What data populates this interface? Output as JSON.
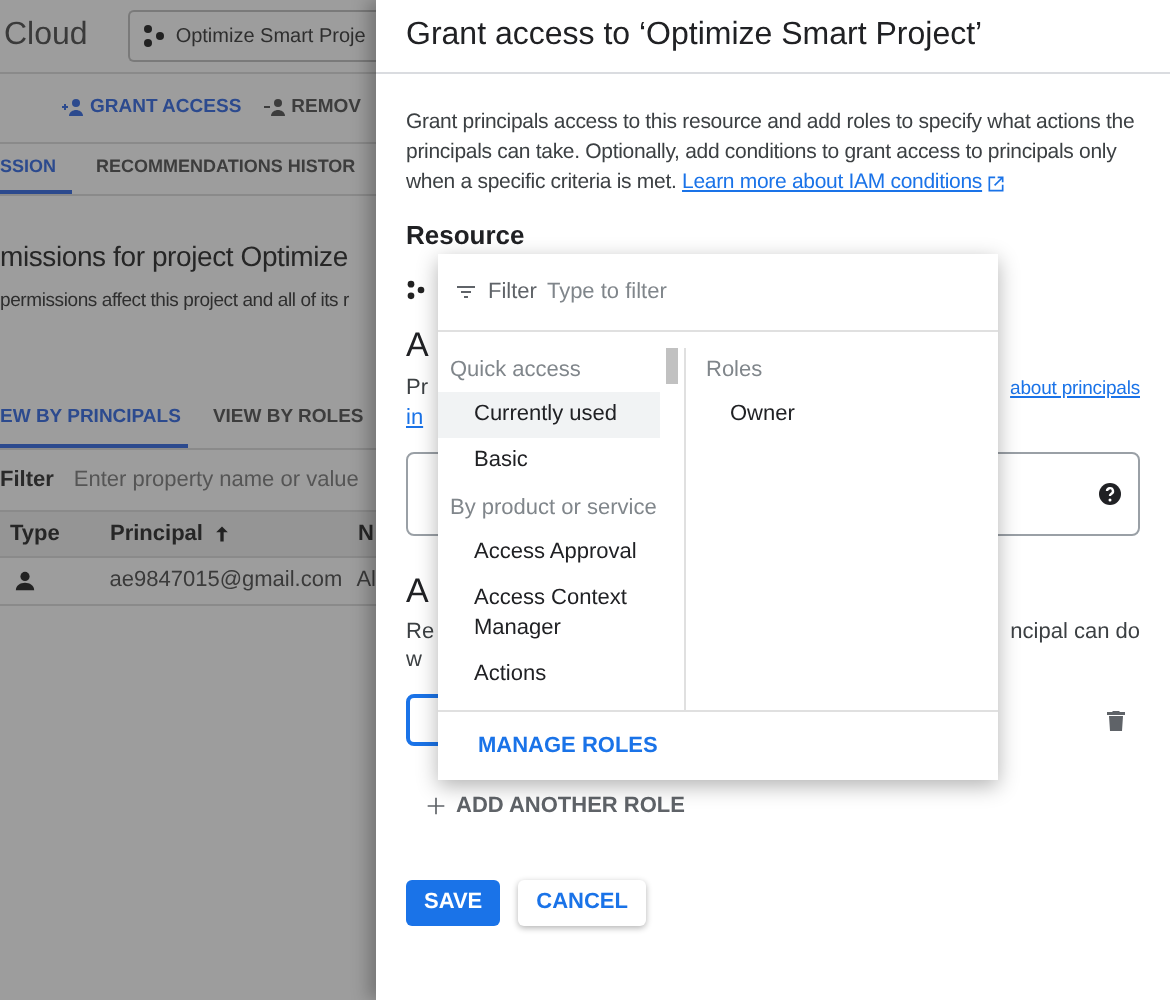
{
  "background_page": {
    "brand": "Cloud",
    "project_selector": "Optimize Smart Proje",
    "toolbar": [
      {
        "kind": "add",
        "label": "GRANT ACCESS"
      },
      {
        "kind": "remove",
        "label": "REMOV"
      }
    ],
    "tabs": [
      {
        "label": "SSION",
        "selected": true
      },
      {
        "label": "RECOMMENDATIONS HISTOR",
        "selected": false
      }
    ],
    "heading": "missions for project Optimize",
    "subtitle": "permissions affect this project and all of its r",
    "view_tabs": [
      {
        "label": "EW BY PRINCIPALS",
        "selected": true
      },
      {
        "label": "VIEW BY ROLES",
        "selected": false
      }
    ],
    "filter": {
      "label": "Filter",
      "placeholder": "Enter property name or value"
    },
    "table": {
      "columns": [
        "Type",
        "Principal",
        "N"
      ],
      "rows": [
        {
          "principal": "ae9847015@gmail.com",
          "column_3": "Al"
        }
      ]
    }
  },
  "panel": {
    "title": "Grant access to ‘Optimize Smart Project’",
    "description": "Grant principals access to this resource and add roles to specify what actions the principals can take. Optionally, add conditions to grant access to principals only when a specific criteria is met.",
    "learn_more_link": "Learn more about IAM conditions",
    "resource_label": "Resource",
    "principals_heading": "A",
    "principals_text": "Pr",
    "principals_text_2": "in",
    "principals_link": "about principals",
    "roles_heading": "A",
    "roles_text": "Re",
    "roles_text_end": "ncipal can do",
    "roles_text_2": "w",
    "add_another_role": "ADD ANOTHER ROLE",
    "buttons": [
      {
        "kind": "primary",
        "label": "SAVE"
      },
      {
        "kind": "secondary",
        "label": "CANCEL"
      }
    ]
  },
  "role_dropdown": {
    "filter_label": "Filter",
    "placeholder": "Type to filter",
    "groups": [
      {
        "heading": "Quick access",
        "items": [
          {
            "label": "Currently used",
            "selected": true
          },
          {
            "label": "Basic",
            "selected": false
          }
        ]
      },
      {
        "heading": "By product or service",
        "items": [
          {
            "label": "Access Approval",
            "selected": false
          },
          {
            "label": "Access Context Manager",
            "selected": false
          },
          {
            "label": "Actions",
            "selected": false
          }
        ]
      }
    ],
    "roles_heading": "Roles",
    "roles": [
      "Owner"
    ],
    "manage_roles": "MANAGE ROLES"
  }
}
